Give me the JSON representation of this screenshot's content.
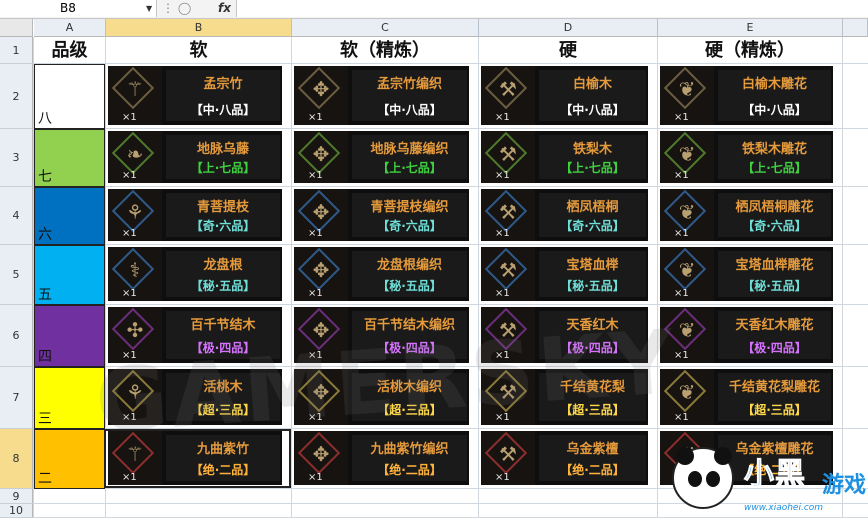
{
  "formula_bar": {
    "cell_ref": "B8",
    "fx": "fx",
    "value": ""
  },
  "columns": [
    {
      "letter": "A",
      "selected": false
    },
    {
      "letter": "B",
      "selected": true
    },
    {
      "letter": "C",
      "selected": false
    },
    {
      "letter": "D",
      "selected": false
    },
    {
      "letter": "E",
      "selected": false
    }
  ],
  "rows": [
    "1",
    "2",
    "3",
    "4",
    "5",
    "6",
    "7",
    "8",
    "9",
    "10"
  ],
  "header": {
    "grade": "品级",
    "soft": "软",
    "soft_refined": "软（精炼）",
    "hard": "硬",
    "hard_refined": "硬（精炼）"
  },
  "grades": [
    {
      "label": "八",
      "color": "#ffffff"
    },
    {
      "label": "七",
      "color": "#92d050"
    },
    {
      "label": "六",
      "color": "#0070c0"
    },
    {
      "label": "五",
      "color": "#00b0f0"
    },
    {
      "label": "四",
      "color": "#7030a0"
    },
    {
      "label": "三",
      "color": "#ffff00"
    },
    {
      "label": "二",
      "color": "#ffc000"
    }
  ],
  "items": [
    [
      {
        "name": "孟宗竹",
        "grade": "【中·八品】",
        "count": "×1",
        "icon": "bamboo-icon"
      },
      {
        "name": "孟宗竹编织",
        "grade": "【中·八品】",
        "count": "×1",
        "icon": "weave-icon"
      },
      {
        "name": "白榆木",
        "grade": "【中·八品】",
        "count": "×1",
        "icon": "wood-icon"
      },
      {
        "name": "白榆木雕花",
        "grade": "【中·八品】",
        "count": "×1",
        "icon": "carving-icon"
      }
    ],
    [
      {
        "name": "地脉乌藤",
        "grade": "【上·七品】",
        "count": "×1",
        "icon": "vine-icon"
      },
      {
        "name": "地脉乌藤编织",
        "grade": "【上·七品】",
        "count": "×1",
        "icon": "weave-icon"
      },
      {
        "name": "铁梨木",
        "grade": "【上·七品】",
        "count": "×1",
        "icon": "wood-icon"
      },
      {
        "name": "铁梨木雕花",
        "grade": "【上·七品】",
        "count": "×1",
        "icon": "carving-icon"
      }
    ],
    [
      {
        "name": "青菩提枝",
        "grade": "【奇·六品】",
        "count": "×1",
        "icon": "branch-icon"
      },
      {
        "name": "青菩提枝编织",
        "grade": "【奇·六品】",
        "count": "×1",
        "icon": "weave-icon"
      },
      {
        "name": "栖凤梧桐",
        "grade": "【奇·六品】",
        "count": "×1",
        "icon": "wood-icon"
      },
      {
        "name": "栖凤梧桐雕花",
        "grade": "【奇·六品】",
        "count": "×1",
        "icon": "carving-icon"
      }
    ],
    [
      {
        "name": "龙盘根",
        "grade": "【秘·五品】",
        "count": "×1",
        "icon": "root-icon"
      },
      {
        "name": "龙盘根编织",
        "grade": "【秘·五品】",
        "count": "×1",
        "icon": "weave-icon"
      },
      {
        "name": "宝塔血榉",
        "grade": "【秘·五品】",
        "count": "×1",
        "icon": "wood-icon"
      },
      {
        "name": "宝塔血榉雕花",
        "grade": "【秘·五品】",
        "count": "×1",
        "icon": "carving-icon"
      }
    ],
    [
      {
        "name": "百千节结木",
        "grade": "【极·四品】",
        "count": "×1",
        "icon": "knot-wood-icon"
      },
      {
        "name": "百千节结木编织",
        "grade": "【极·四品】",
        "count": "×1",
        "icon": "weave-icon"
      },
      {
        "name": "天香红木",
        "grade": "【极·四品】",
        "count": "×1",
        "icon": "wood-icon"
      },
      {
        "name": "天香红木雕花",
        "grade": "【极·四品】",
        "count": "×1",
        "icon": "carving-icon"
      }
    ],
    [
      {
        "name": "活桃木",
        "grade": "【超·三品】",
        "count": "×1",
        "icon": "branch-icon"
      },
      {
        "name": "活桃木编织",
        "grade": "【超·三品】",
        "count": "×1",
        "icon": "weave-icon"
      },
      {
        "name": "千结黄花梨",
        "grade": "【超·三品】",
        "count": "×1",
        "icon": "wood-icon"
      },
      {
        "name": "千结黄花梨雕花",
        "grade": "【超·三品】",
        "count": "×1",
        "icon": "carving-icon"
      }
    ],
    [
      {
        "name": "九曲紫竹",
        "grade": "【绝·二品】",
        "count": "×1",
        "icon": "bamboo-icon"
      },
      {
        "name": "九曲紫竹编织",
        "grade": "【绝·二品】",
        "count": "×1",
        "icon": "weave-icon"
      },
      {
        "name": "乌金紫檀",
        "grade": "【绝·二品】",
        "count": "×1",
        "icon": "wood-icon"
      },
      {
        "name": "乌金紫檀雕花",
        "grade": "【绝·二品】",
        "count": "×1",
        "icon": "carving-icon"
      }
    ]
  ],
  "watermark": "GAMERSKY",
  "logo": {
    "text": "小黑",
    "text2": "游戏",
    "url": "www.xiaohei.com"
  }
}
